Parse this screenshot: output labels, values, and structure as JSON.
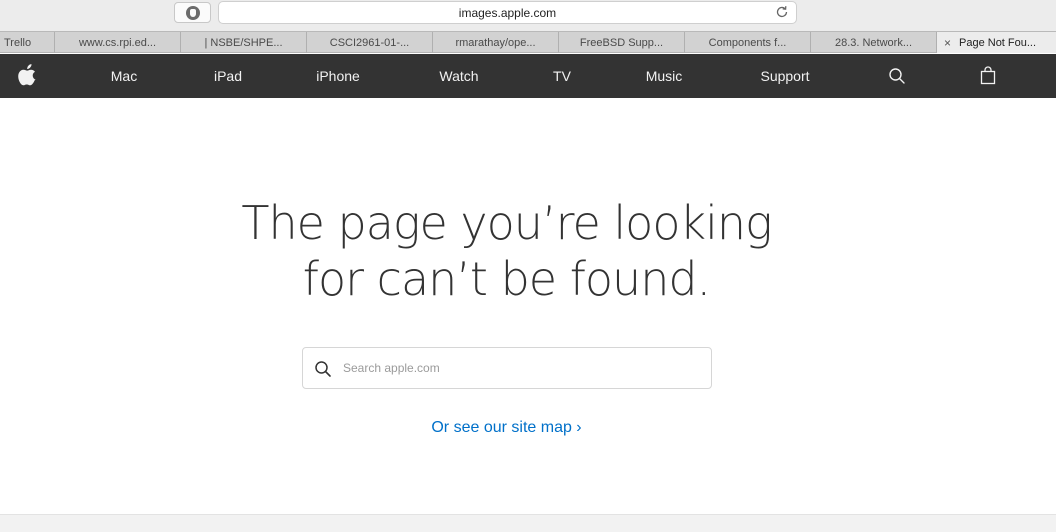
{
  "browser": {
    "url": "images.apple.com",
    "tabs": [
      {
        "label": "Trello"
      },
      {
        "label": "www.cs.rpi.ed..."
      },
      {
        "label": "| NSBE/SHPE..."
      },
      {
        "label": "CSCI2961-01-..."
      },
      {
        "label": "rmarathay/ope..."
      },
      {
        "label": "FreeBSD Supp..."
      },
      {
        "label": "Components f..."
      },
      {
        "label": "28.3. Network..."
      },
      {
        "label": "Page Not Fou..."
      }
    ],
    "active_tab_close": "×"
  },
  "nav": {
    "items": [
      {
        "label": "Mac"
      },
      {
        "label": "iPad"
      },
      {
        "label": "iPhone"
      },
      {
        "label": "Watch"
      },
      {
        "label": "TV"
      },
      {
        "label": "Music"
      },
      {
        "label": "Support"
      }
    ],
    "icons": [
      "apple-logo-icon",
      "search-icon",
      "shopping-bag-icon"
    ]
  },
  "main": {
    "headline_line1": "The page you’re looking",
    "headline_line2": "for can’t be found.",
    "search_placeholder": "Search apple.com",
    "sitemap_link": "Or see our site map ›"
  },
  "colors": {
    "nav_bg": "#333333",
    "link": "#0070c9",
    "text": "#333333"
  }
}
